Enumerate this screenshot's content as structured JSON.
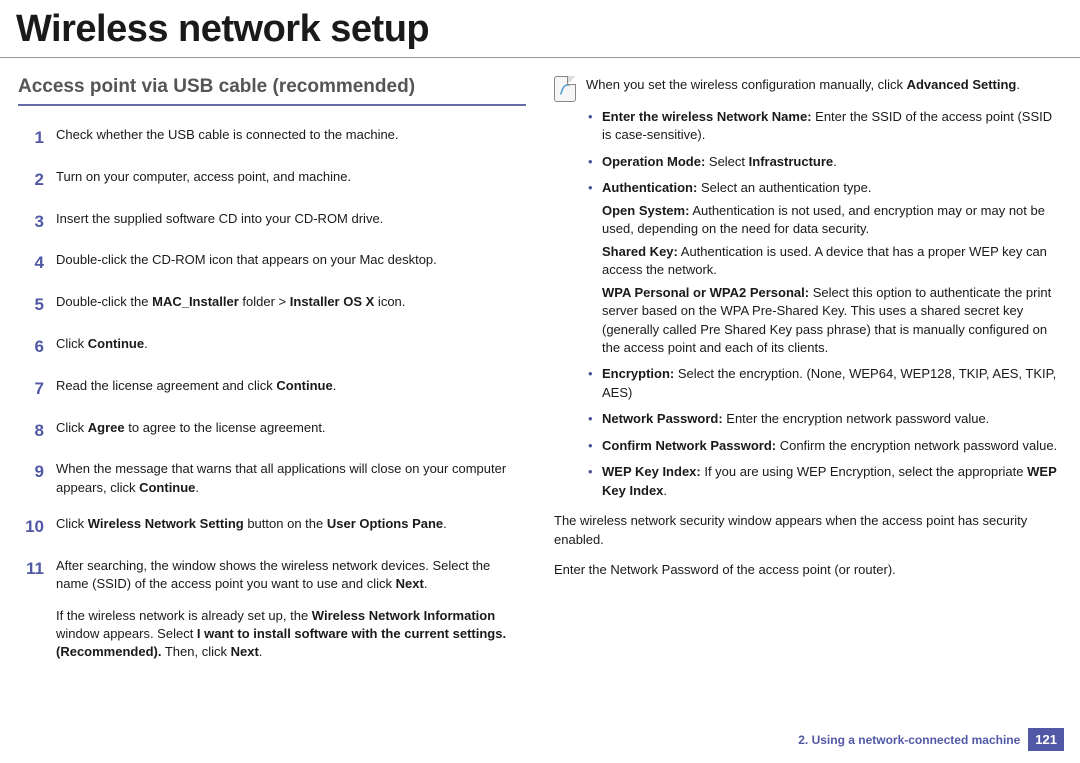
{
  "title": "Wireless network setup",
  "section_heading": "Access point via USB cable (recommended)",
  "steps": [
    {
      "n": "1",
      "body": [
        "Check whether the USB cable is connected to the machine."
      ]
    },
    {
      "n": "2",
      "body": [
        "Turn on your computer, access point, and machine."
      ]
    },
    {
      "n": "3",
      "body": [
        "Insert the supplied software CD into your CD-ROM drive."
      ]
    },
    {
      "n": "4",
      "body": [
        "Double-click the CD-ROM icon that appears on your Mac desktop."
      ]
    },
    {
      "n": "5",
      "body": [
        "Double-click the <b>MAC_Installer</b> folder > <b>Installer OS X</b> icon."
      ]
    },
    {
      "n": "6",
      "body": [
        "Click <b>Continue</b>."
      ]
    },
    {
      "n": "7",
      "body": [
        "Read the license agreement and click <b>Continue</b>."
      ]
    },
    {
      "n": "8",
      "body": [
        "Click <b>Agree</b> to agree to the license agreement."
      ]
    },
    {
      "n": "9",
      "body": [
        "When the message that warns that all applications will close on your computer appears, click <b>Continue</b>."
      ]
    },
    {
      "n": "10",
      "body": [
        "Click <b>Wireless Network Setting</b> button on the <b>User Options Pane</b>."
      ]
    },
    {
      "n": "11",
      "body": [
        "After searching, the window shows the wireless network devices. Select the name (SSID) of the access point you want to use and click <b>Next</b>.",
        "If the wireless network is already set up, the <b>Wireless Network Information</b> window appears. Select <b>I want to install software with the current settings. (Recommended).</b> Then, click <b>Next</b>."
      ]
    }
  ],
  "note_lead": "When you set the wireless configuration manually, click <b>Advanced Setting</b>.",
  "bullets": [
    "<b>Enter the wireless Network Name:</b> Enter the SSID of the access point (SSID is case-sensitive).",
    "<b>Operation Mode:</b> Select <b>Infrastructure</b>.",
    "<b>Authentication:</b> Select an authentication type.<div class='sub-p'><b>Open System:</b> Authentication is not used, and encryption may or may not be used, depending on the need for data security.</div><div class='sub-p'><b>Shared Key:</b> Authentication is used. A device that has a proper WEP key can access the network.</div><div class='sub-p'><b>WPA Personal or WPA2 Personal:</b> Select this option to authenticate the print server based on the WPA Pre-Shared Key. This uses a shared secret key (generally called Pre Shared Key pass phrase) that is manually configured on the access point and each of its clients.</div>",
    "<b>Encryption:</b> Select the encryption. (None, WEP64, WEP128, TKIP, AES, TKIP, AES)",
    "<b>Network Password:</b> Enter the encryption network password value.",
    "<b>Confirm Network Password:</b> Confirm the encryption network password value.",
    "<b>WEP Key Index:</b> If you are using WEP Encryption, select the appropriate <b>WEP Key Index</b>."
  ],
  "tail_paras": [
    "The wireless network security window appears when the access point has security enabled.",
    "Enter the Network Password of the access point (or router)."
  ],
  "footer": {
    "chapter": "2.  Using a network-connected machine",
    "page": "121"
  }
}
